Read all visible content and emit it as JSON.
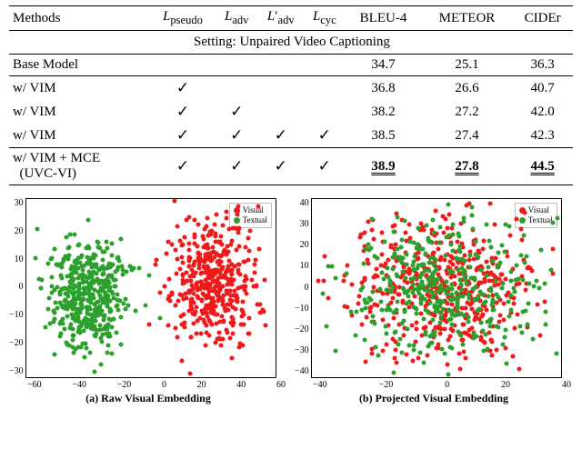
{
  "table": {
    "headers": [
      "Methods",
      "𝐿_pseudo",
      "𝐿_adv",
      "𝐿′_adv",
      "𝐿_cyc",
      "BLEU-4",
      "METEOR",
      "CIDEr"
    ],
    "setting": "Setting: Unpaired Video Captioning",
    "rows": [
      {
        "name": "Base Model",
        "c": [
          "",
          "",
          "",
          ""
        ],
        "m": [
          "34.7",
          "25.1",
          "36.3"
        ]
      },
      {
        "name": "w/ VIM",
        "c": [
          "✓",
          "",
          "",
          ""
        ],
        "m": [
          "36.8",
          "26.6",
          "40.7"
        ]
      },
      {
        "name": "w/ VIM",
        "c": [
          "✓",
          "✓",
          "",
          ""
        ],
        "m": [
          "38.2",
          "27.2",
          "42.0"
        ]
      },
      {
        "name": "w/ VIM",
        "c": [
          "✓",
          "✓",
          "✓",
          "✓"
        ],
        "m": [
          "38.5",
          "27.4",
          "42.3"
        ]
      },
      {
        "name": "w/ VIM + MCE\n(UVC-VI)",
        "c": [
          "✓",
          "✓",
          "✓",
          "✓"
        ],
        "m": [
          "38.9",
          "27.8",
          "44.5"
        ],
        "best": true
      }
    ]
  },
  "legend": {
    "visual": "Visual",
    "textual": "Textual"
  },
  "captions": {
    "a": "(a) Raw Visual Embedding",
    "b": "(b) Projected Visual Embedding"
  },
  "chart_data": [
    {
      "type": "scatter",
      "title": "(a) Raw Visual Embedding",
      "xlim": [
        -70,
        70
      ],
      "ylim": [
        -35,
        35
      ],
      "xticks": [
        -60,
        -40,
        -20,
        0,
        20,
        40,
        60
      ],
      "yticks": [
        -30,
        -20,
        -10,
        0,
        10,
        20,
        30
      ],
      "series": [
        {
          "name": "Visual",
          "color": "#ef1a1a",
          "cluster_center": [
            35,
            2
          ],
          "cluster_spread": [
            26,
            26
          ],
          "n": 450
        },
        {
          "name": "Textual",
          "color": "#2ca02c",
          "cluster_center": [
            -35,
            -3
          ],
          "cluster_spread": [
            24,
            24
          ],
          "n": 450
        }
      ]
    },
    {
      "type": "scatter",
      "title": "(b) Projected Visual Embedding",
      "xlim": [
        -55,
        55
      ],
      "ylim": [
        -45,
        45
      ],
      "xticks": [
        -40,
        -20,
        0,
        20,
        40
      ],
      "yticks": [
        -40,
        -30,
        -20,
        -10,
        0,
        10,
        20,
        30,
        40
      ],
      "series": [
        {
          "name": "Visual",
          "color": "#ef1a1a",
          "cluster_center": [
            2,
            0
          ],
          "cluster_spread": [
            45,
            38
          ],
          "n": 500
        },
        {
          "name": "Textual",
          "color": "#2ca02c",
          "cluster_center": [
            2,
            0
          ],
          "cluster_spread": [
            45,
            38
          ],
          "n": 400
        }
      ]
    }
  ]
}
